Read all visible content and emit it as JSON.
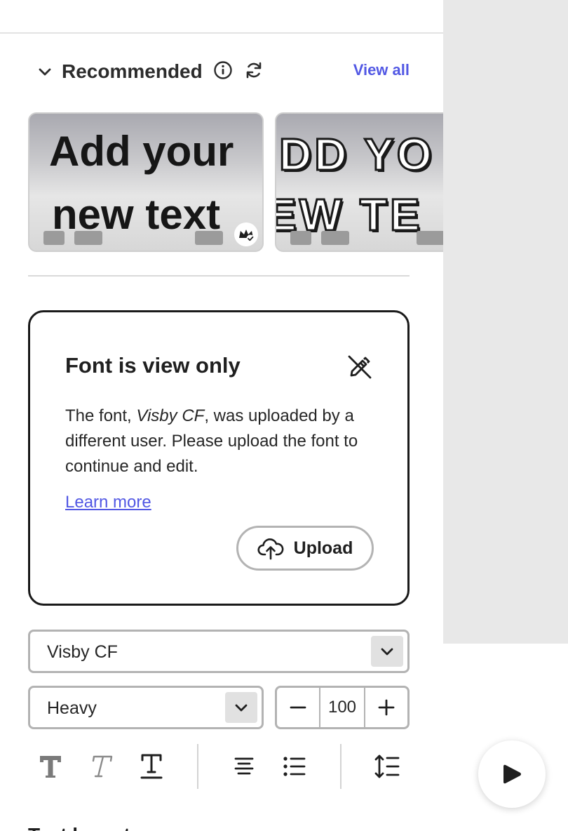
{
  "recommended": {
    "title": "Recommended",
    "view_all": "View all"
  },
  "templates": [
    {
      "line1": "Add your",
      "line2": "new text",
      "premium": true
    },
    {
      "line1": "DD YO",
      "line2": "EW TE",
      "premium": false
    }
  ],
  "alert": {
    "title": "Font is view only",
    "body_prefix": "The font, ",
    "font_name": "Visby CF",
    "body_suffix": ", was uploaded by a different user. Please upload the font to continue and edit.",
    "learn_more": "Learn more",
    "upload_label": "Upload"
  },
  "font_controls": {
    "family": "Visby CF",
    "weight": "Heavy",
    "size": "100"
  },
  "section_heading": "Text layout",
  "colors": {
    "accent": "#5258e4",
    "border": "#b3b3b3",
    "canvas": "#e8e8e8"
  }
}
